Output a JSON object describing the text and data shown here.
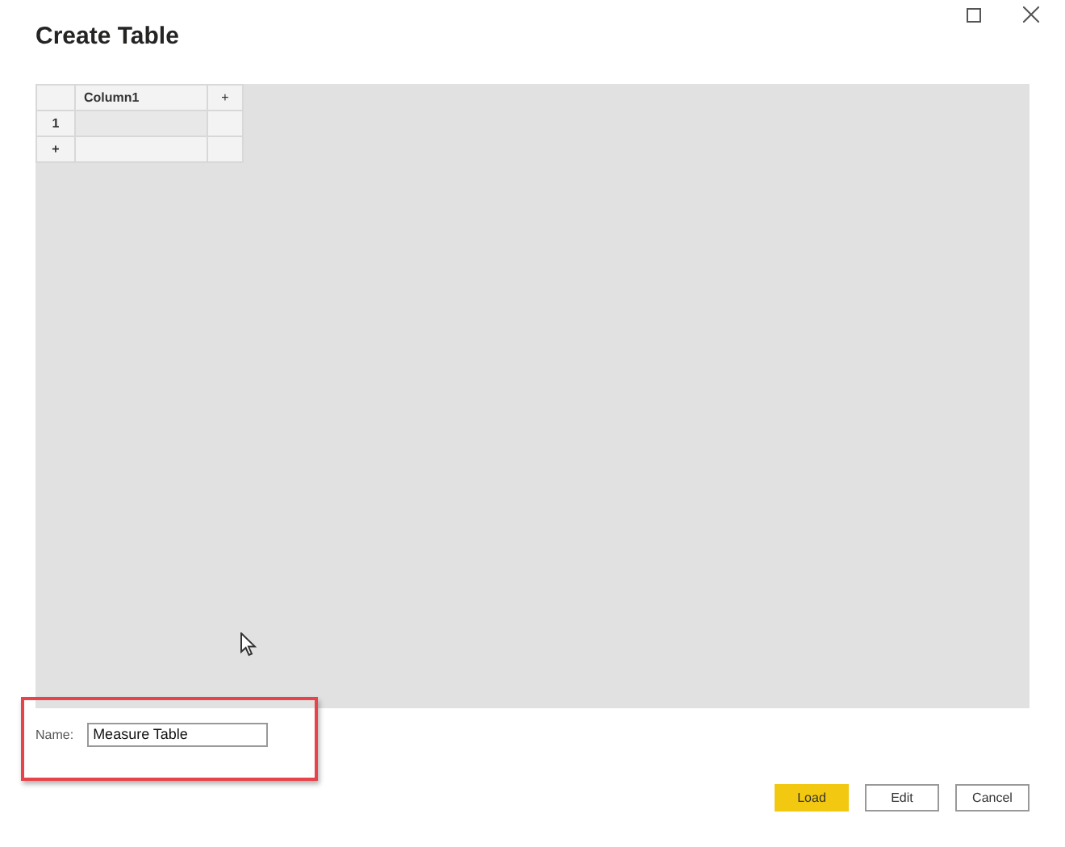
{
  "window": {
    "title": "Create Table"
  },
  "table": {
    "columns": [
      "Column1"
    ],
    "add_column": "+",
    "rows": [
      {
        "number": "1"
      }
    ],
    "add_row": "+"
  },
  "name_field": {
    "label": "Name:",
    "value": "Measure Table"
  },
  "buttons": [
    {
      "label": "Load",
      "kind": "primary"
    },
    {
      "label": "Edit",
      "kind": "secondary"
    },
    {
      "label": "Cancel",
      "kind": "secondary"
    }
  ]
}
